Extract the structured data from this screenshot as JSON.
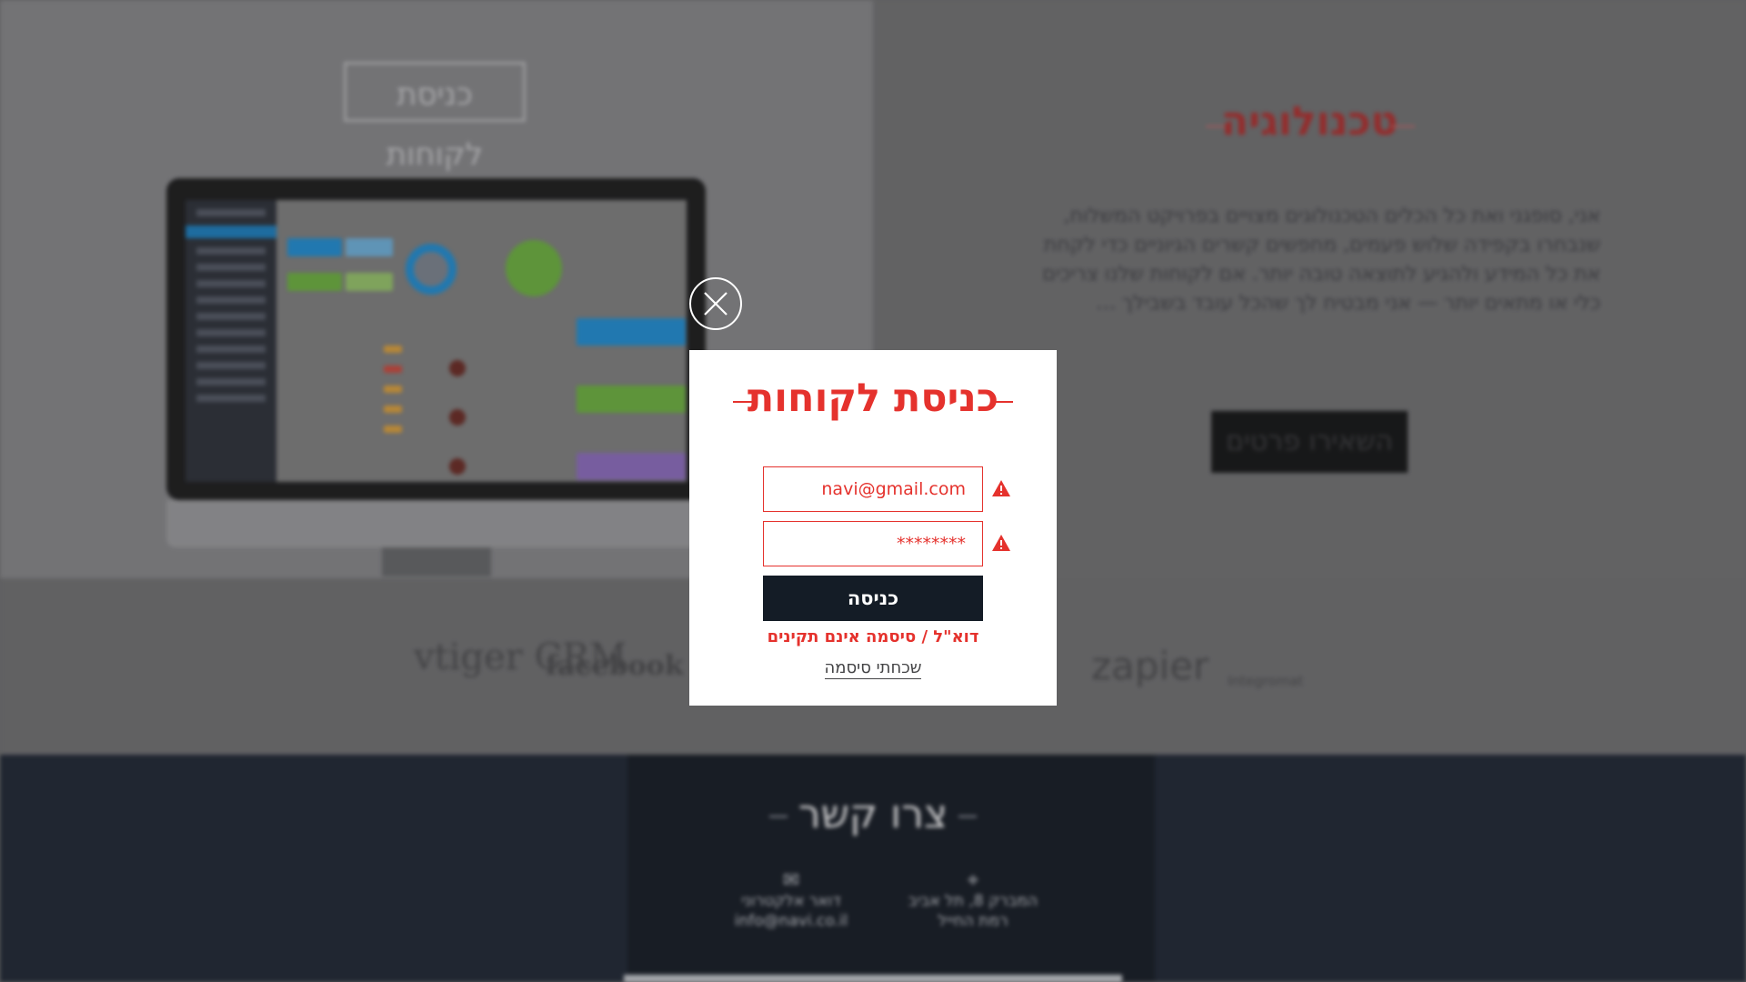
{
  "background": {
    "customers_button_label": "כניסת לקוחות",
    "tech_section": {
      "title": "טכנולוגיה",
      "paragraph": "אני, סופגני ואת כל הכלים הטכנולוגים מצויים בפרויקט המשלוח, שנבחרו בקפידה שלוש פעמים, מחפשים קשרים הגיוניים כדי לקחת את כל המידע ולהגיע לתוצאה טובה יותר. אם לקוחות שלנו צריכים כלי או מתאים יותר — אני מבטיח לך שהכל עובד בשבילך …",
      "details_button_label": "השאירו פרטים"
    },
    "logos": [
      "vtiger CRM",
      "facebook",
      "zapier",
      "Integromat"
    ],
    "contact": {
      "title": "צרו קשר",
      "items": [
        {
          "icon": "envelope-icon",
          "label": "דואר אלקטרוני",
          "value": "info@navi.co.il"
        },
        {
          "icon": "map-pin-icon",
          "label": "המברק 8, תל אביב",
          "value": "רמת החייל"
        }
      ]
    }
  },
  "modal": {
    "title": "כניסת לקוחות",
    "email_value": "navi@gmail.com",
    "password_value": "********",
    "submit_label": "כניסה",
    "error_message": "דוא\"ל / סיסמה אינם תקינים",
    "forgot_label": "שכחתי סיסמה"
  },
  "colors": {
    "accent": "#e5322d",
    "button_dark": "#141c26",
    "modal_bg": "#ffffff"
  }
}
